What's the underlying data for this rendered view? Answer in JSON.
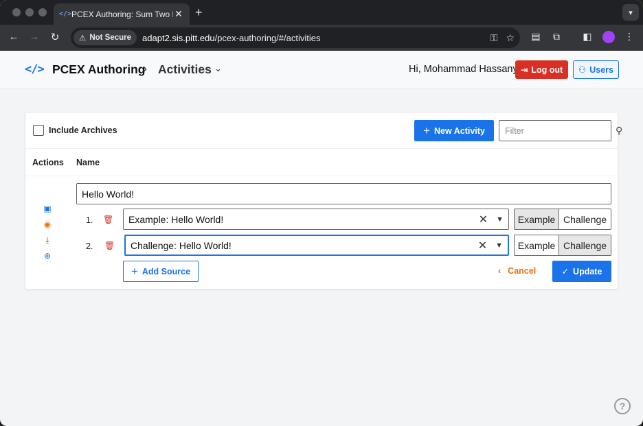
{
  "browser": {
    "tab_title": "PCEX Authoring: Sum Two Nu",
    "security_label": "Not Secure",
    "url_host": "adapt2.sis.pitt.edu",
    "url_path": "/pcex-authoring/#/activities"
  },
  "header": {
    "brand": "PCEX Authoring",
    "breadcrumb_current": "Activities",
    "greeting": "Hi, Mohammad Hassany",
    "logout_label": "Log out",
    "users_label": "Users",
    "accent_color": "#1a73e8",
    "logout_color": "#d93025"
  },
  "toolbar": {
    "include_archives_label": "Include Archives",
    "include_archives_checked": false,
    "new_activity_label": "New Activity",
    "filter_placeholder": "Filter"
  },
  "table": {
    "columns": [
      "Actions",
      "Name"
    ]
  },
  "activity": {
    "name": "Hello World!",
    "actions": [
      "briefcase-icon",
      "eye-icon",
      "download-icon",
      "globe-icon"
    ],
    "sources": [
      {
        "index": "1.",
        "value": "Example: Hello World!",
        "type_selected": "Example",
        "focused": false
      },
      {
        "index": "2.",
        "value": "Challenge: Hello World!",
        "type_selected": "Challenge",
        "focused": true
      }
    ],
    "type_options": [
      "Example",
      "Challenge"
    ],
    "add_source_label": "Add Source",
    "cancel_label": "Cancel",
    "update_label": "Update"
  },
  "help_label": "?"
}
